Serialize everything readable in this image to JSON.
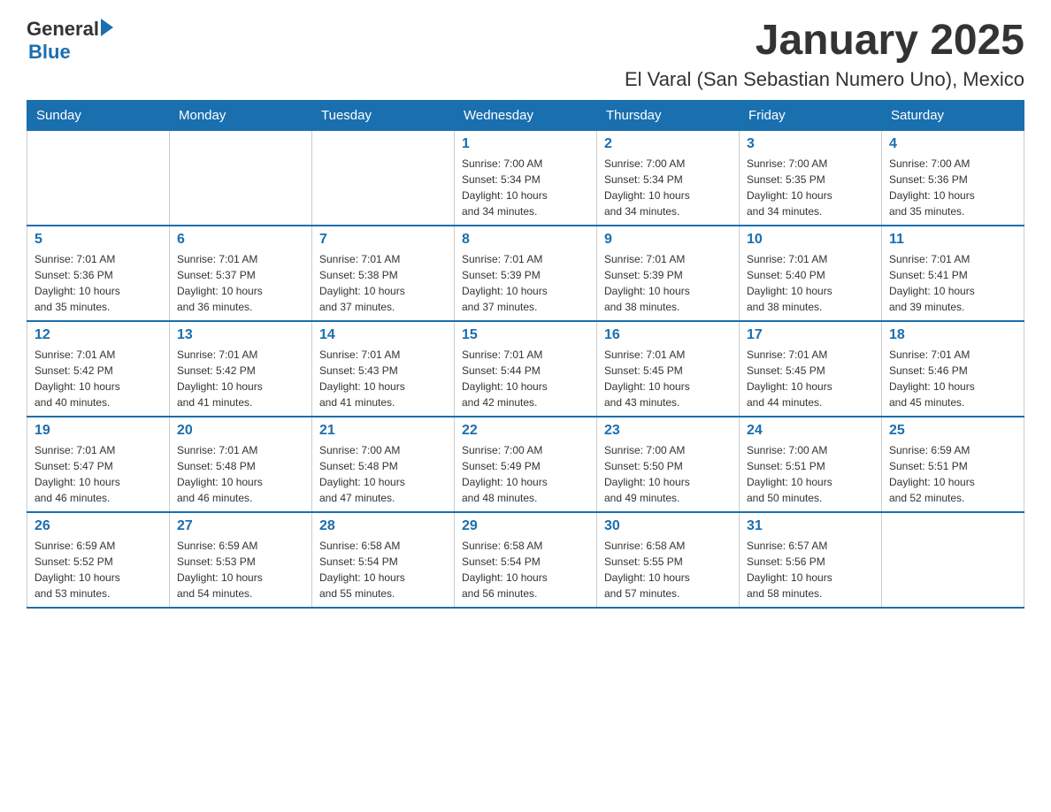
{
  "logo": {
    "text_general": "General",
    "text_blue": "Blue"
  },
  "header": {
    "month_title": "January 2025",
    "location": "El Varal (San Sebastian Numero Uno), Mexico"
  },
  "days_of_week": [
    "Sunday",
    "Monday",
    "Tuesday",
    "Wednesday",
    "Thursday",
    "Friday",
    "Saturday"
  ],
  "weeks": [
    [
      {
        "day": "",
        "info": ""
      },
      {
        "day": "",
        "info": ""
      },
      {
        "day": "",
        "info": ""
      },
      {
        "day": "1",
        "info": "Sunrise: 7:00 AM\nSunset: 5:34 PM\nDaylight: 10 hours\nand 34 minutes."
      },
      {
        "day": "2",
        "info": "Sunrise: 7:00 AM\nSunset: 5:34 PM\nDaylight: 10 hours\nand 34 minutes."
      },
      {
        "day": "3",
        "info": "Sunrise: 7:00 AM\nSunset: 5:35 PM\nDaylight: 10 hours\nand 34 minutes."
      },
      {
        "day": "4",
        "info": "Sunrise: 7:00 AM\nSunset: 5:36 PM\nDaylight: 10 hours\nand 35 minutes."
      }
    ],
    [
      {
        "day": "5",
        "info": "Sunrise: 7:01 AM\nSunset: 5:36 PM\nDaylight: 10 hours\nand 35 minutes."
      },
      {
        "day": "6",
        "info": "Sunrise: 7:01 AM\nSunset: 5:37 PM\nDaylight: 10 hours\nand 36 minutes."
      },
      {
        "day": "7",
        "info": "Sunrise: 7:01 AM\nSunset: 5:38 PM\nDaylight: 10 hours\nand 37 minutes."
      },
      {
        "day": "8",
        "info": "Sunrise: 7:01 AM\nSunset: 5:39 PM\nDaylight: 10 hours\nand 37 minutes."
      },
      {
        "day": "9",
        "info": "Sunrise: 7:01 AM\nSunset: 5:39 PM\nDaylight: 10 hours\nand 38 minutes."
      },
      {
        "day": "10",
        "info": "Sunrise: 7:01 AM\nSunset: 5:40 PM\nDaylight: 10 hours\nand 38 minutes."
      },
      {
        "day": "11",
        "info": "Sunrise: 7:01 AM\nSunset: 5:41 PM\nDaylight: 10 hours\nand 39 minutes."
      }
    ],
    [
      {
        "day": "12",
        "info": "Sunrise: 7:01 AM\nSunset: 5:42 PM\nDaylight: 10 hours\nand 40 minutes."
      },
      {
        "day": "13",
        "info": "Sunrise: 7:01 AM\nSunset: 5:42 PM\nDaylight: 10 hours\nand 41 minutes."
      },
      {
        "day": "14",
        "info": "Sunrise: 7:01 AM\nSunset: 5:43 PM\nDaylight: 10 hours\nand 41 minutes."
      },
      {
        "day": "15",
        "info": "Sunrise: 7:01 AM\nSunset: 5:44 PM\nDaylight: 10 hours\nand 42 minutes."
      },
      {
        "day": "16",
        "info": "Sunrise: 7:01 AM\nSunset: 5:45 PM\nDaylight: 10 hours\nand 43 minutes."
      },
      {
        "day": "17",
        "info": "Sunrise: 7:01 AM\nSunset: 5:45 PM\nDaylight: 10 hours\nand 44 minutes."
      },
      {
        "day": "18",
        "info": "Sunrise: 7:01 AM\nSunset: 5:46 PM\nDaylight: 10 hours\nand 45 minutes."
      }
    ],
    [
      {
        "day": "19",
        "info": "Sunrise: 7:01 AM\nSunset: 5:47 PM\nDaylight: 10 hours\nand 46 minutes."
      },
      {
        "day": "20",
        "info": "Sunrise: 7:01 AM\nSunset: 5:48 PM\nDaylight: 10 hours\nand 46 minutes."
      },
      {
        "day": "21",
        "info": "Sunrise: 7:00 AM\nSunset: 5:48 PM\nDaylight: 10 hours\nand 47 minutes."
      },
      {
        "day": "22",
        "info": "Sunrise: 7:00 AM\nSunset: 5:49 PM\nDaylight: 10 hours\nand 48 minutes."
      },
      {
        "day": "23",
        "info": "Sunrise: 7:00 AM\nSunset: 5:50 PM\nDaylight: 10 hours\nand 49 minutes."
      },
      {
        "day": "24",
        "info": "Sunrise: 7:00 AM\nSunset: 5:51 PM\nDaylight: 10 hours\nand 50 minutes."
      },
      {
        "day": "25",
        "info": "Sunrise: 6:59 AM\nSunset: 5:51 PM\nDaylight: 10 hours\nand 52 minutes."
      }
    ],
    [
      {
        "day": "26",
        "info": "Sunrise: 6:59 AM\nSunset: 5:52 PM\nDaylight: 10 hours\nand 53 minutes."
      },
      {
        "day": "27",
        "info": "Sunrise: 6:59 AM\nSunset: 5:53 PM\nDaylight: 10 hours\nand 54 minutes."
      },
      {
        "day": "28",
        "info": "Sunrise: 6:58 AM\nSunset: 5:54 PM\nDaylight: 10 hours\nand 55 minutes."
      },
      {
        "day": "29",
        "info": "Sunrise: 6:58 AM\nSunset: 5:54 PM\nDaylight: 10 hours\nand 56 minutes."
      },
      {
        "day": "30",
        "info": "Sunrise: 6:58 AM\nSunset: 5:55 PM\nDaylight: 10 hours\nand 57 minutes."
      },
      {
        "day": "31",
        "info": "Sunrise: 6:57 AM\nSunset: 5:56 PM\nDaylight: 10 hours\nand 58 minutes."
      },
      {
        "day": "",
        "info": ""
      }
    ]
  ]
}
